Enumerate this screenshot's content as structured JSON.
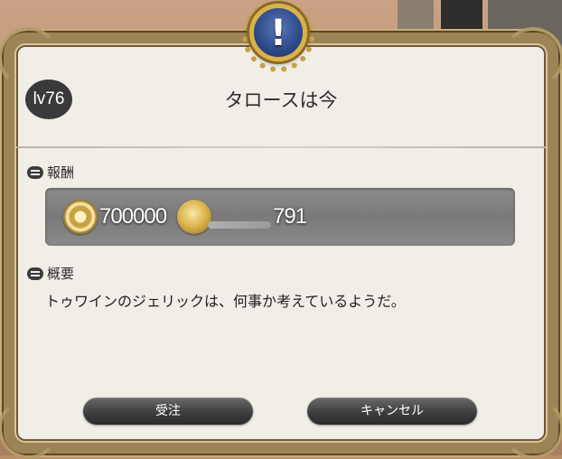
{
  "quest": {
    "level": "lv76",
    "title": "タロースは今"
  },
  "reward": {
    "label": "報酬",
    "exp": "700000",
    "gil": "791"
  },
  "summary": {
    "label": "概要",
    "text": "トゥワインのジェリックは、何事か考えているようだ。"
  },
  "buttons": {
    "accept": "受注",
    "cancel": "キャンセル"
  },
  "icons": {
    "emblem": "exclamation-icon",
    "exp": "exp-icon",
    "gil": "gil-coin-icon"
  },
  "colors": {
    "frame": "#9c8457",
    "panel": "#f1eee8",
    "emblem": "#2c4a8a",
    "button": "#3e3e3e"
  }
}
